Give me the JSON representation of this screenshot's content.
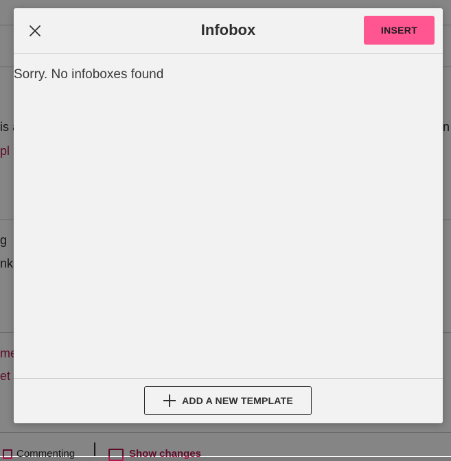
{
  "background": {
    "line1_left": "is a",
    "line1_right": "n",
    "line2_link": "pl",
    "line3_left": "g",
    "line4_left": "nk",
    "line5_link": "me",
    "line6_link": "et",
    "footer_commenting": "Commenting",
    "footer_show_changes": "Show changes"
  },
  "modal": {
    "title": "Infobox",
    "insert_label": "INSERT",
    "empty_message": "Sorry. No infoboxes found",
    "add_template_label": "ADD A NEW TEMPLATE"
  },
  "icons": {
    "close": "close-icon",
    "add": "plus-icon"
  },
  "colors": {
    "accent": "#ff5591",
    "link": "#b0184f",
    "modal_bg": "#f2f2f2"
  }
}
